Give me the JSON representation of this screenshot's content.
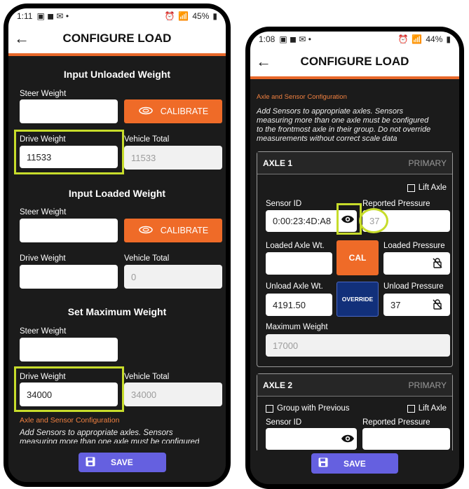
{
  "left": {
    "status": {
      "time": "1:11",
      "battery": "45%"
    },
    "title": "CONFIGURE LOAD",
    "unloaded": {
      "heading": "Input Unloaded Weight",
      "steer_label": "Steer Weight",
      "steer_value": "",
      "calibrate": "CALIBRATE",
      "drive_label": "Drive Weight",
      "drive_value": "11533",
      "total_label": "Vehicle Total",
      "total_value": "11533"
    },
    "loaded": {
      "heading": "Input Loaded Weight",
      "steer_label": "Steer Weight",
      "steer_value": "",
      "calibrate": "CALIBRATE",
      "drive_label": "Drive Weight",
      "drive_value": "",
      "total_label": "Vehicle Total",
      "total_value": "0"
    },
    "maximum": {
      "heading": "Set Maximum Weight",
      "steer_label": "Steer Weight",
      "steer_value": "",
      "drive_label": "Drive Weight",
      "drive_value": "34000",
      "total_label": "Vehicle Total",
      "total_value": "34000"
    },
    "section_title": "Axle and Sensor Configuration",
    "note_l1": "Add Sensors to appropriate axles. Sensors",
    "note_l2": "measuring more than one axle must be configured",
    "save": "SAVE"
  },
  "right": {
    "status": {
      "time": "1:08",
      "battery": "44%"
    },
    "title": "CONFIGURE LOAD",
    "section_title": "Axle and Sensor Configuration",
    "note_l1": "Add Sensors to appropriate axles. Sensors",
    "note_l2": "measuring more than one axle must be configured",
    "note_l3": "to the frontmost axle in their group. Do not override",
    "note_l4": "measurements without correct scale data",
    "axle1": {
      "name": "AXLE 1",
      "role": "PRIMARY",
      "lift": "Lift Axle",
      "sensor_label": "Sensor ID",
      "sensor_value": "0:00:23:4D:A8",
      "pressure_label": "Reported Pressure",
      "pressure_value": "37",
      "loaded_label": "Loaded Axle Wt.",
      "loaded_value": "",
      "cal": "CAL",
      "loaded_pressure_label": "Loaded Pressure",
      "loaded_pressure_value": "",
      "unload_label": "Unload Axle Wt.",
      "unload_value": "4191.50",
      "override": "OVERRIDE",
      "unload_pressure_label": "Unload Pressure",
      "unload_pressure_value": "37",
      "max_label": "Maximum Weight",
      "max_value": "17000"
    },
    "axle2": {
      "name": "AXLE 2",
      "role": "PRIMARY",
      "group": "Group with Previous",
      "lift": "Lift Axle",
      "sensor_label": "Sensor ID",
      "sensor_value": "",
      "pressure_label": "Reported Pressure",
      "pressure_value": ""
    },
    "save": "SAVE"
  },
  "colors": {
    "accent": "#ef6b28",
    "highlight": "#c7dc2b",
    "save": "#6560e0",
    "background": "#1b1b1b"
  }
}
